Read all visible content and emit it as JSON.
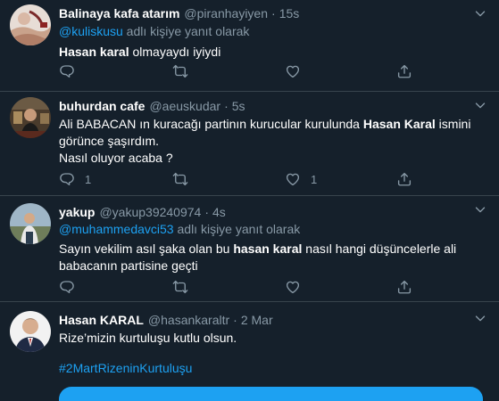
{
  "tweets": [
    {
      "name": "Balinaya kafa atarım",
      "handle": "@piranhayiyen",
      "time": "15s",
      "reply_prefix": "",
      "reply_mention": "@kuliskusu",
      "reply_suffix": " adlı kişiye yanıt olarak",
      "body": [
        {
          "bold": "Hasan karal",
          "text": " olmayaydı iyiydi"
        }
      ],
      "replies": "",
      "retweets": "",
      "likes": ""
    },
    {
      "name": "buhurdan cafe",
      "handle": "@aeuskudar",
      "time": "5s",
      "body_lines": [
        {
          "pre": "Ali BABACAN ın kuracağı partinın kurucular kurulunda ",
          "bold": "Hasan Karal",
          "post": " ismini"
        },
        {
          "pre": "görünce şaşırdım.",
          "bold": "",
          "post": ""
        },
        {
          "pre": "Nasıl oluyor acaba ?",
          "bold": "",
          "post": ""
        }
      ],
      "replies": "1",
      "retweets": "",
      "likes": "1"
    },
    {
      "name": "yakup",
      "handle": "@yakup39240974",
      "time": "4s",
      "reply_mention": "@muhammedavci53",
      "reply_suffix": " adlı kişiye yanıt olarak",
      "body_lines": [
        {
          "pre": "Sayın vekilim asıl şaka olan bu ",
          "bold": "hasan karal",
          "post": " nasıl hangi düşüncelerle ali"
        },
        {
          "pre": "babacanın partisine geçti",
          "bold": "",
          "post": ""
        }
      ],
      "replies": "",
      "retweets": "",
      "likes": ""
    },
    {
      "name": "Hasan KARAL",
      "handle": "@hasankaraltr",
      "time": "2 Mar",
      "body": "Rize’mizin kurtuluşu kutlu olsun.",
      "hashtag": "#2MartRizeninKurtuluşu"
    }
  ],
  "colors": {
    "background": "#15202b",
    "border": "#38444d",
    "secondary_text": "#8899a6",
    "accent": "#1da1f2"
  },
  "icons": [
    "reply-icon",
    "retweet-icon",
    "like-icon",
    "share-icon",
    "chevron-down-icon"
  ]
}
